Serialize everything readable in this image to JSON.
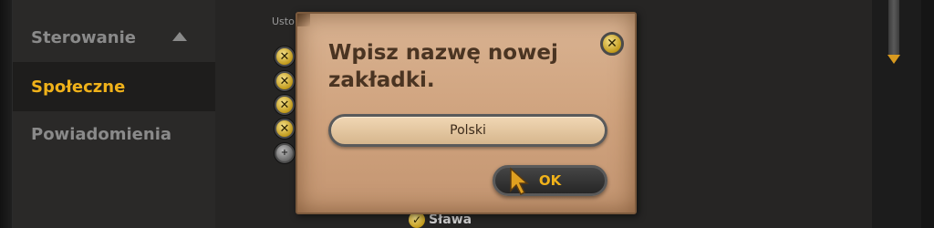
{
  "sidebar": {
    "items": [
      {
        "label": "Sterowanie"
      },
      {
        "label": "Społeczne"
      },
      {
        "label": "Powiadomienia"
      }
    ]
  },
  "main": {
    "section_label": "Usto",
    "bottom_item_label": "Sława"
  },
  "dialog": {
    "title": "Wpisz nazwę nowej zakładki.",
    "input_value": "Polski",
    "ok_label": "OK"
  },
  "icons": {
    "close": "close-icon",
    "check": "check-icon",
    "collapse": "chevron-up-icon",
    "scroll": "scroll-down-arrow-icon",
    "cursor": "mouse-cursor-icon"
  },
  "colors": {
    "accent": "#f0b21a",
    "parchment": "#cfa27d",
    "sidebar_bg": "#2a2928"
  }
}
